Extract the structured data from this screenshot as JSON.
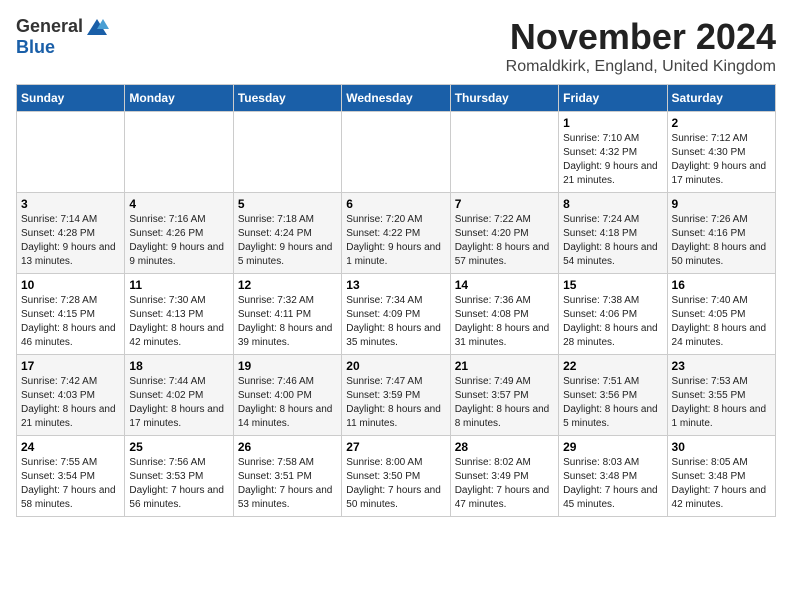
{
  "header": {
    "logo_general": "General",
    "logo_blue": "Blue",
    "month": "November 2024",
    "location": "Romaldkirk, England, United Kingdom"
  },
  "days_of_week": [
    "Sunday",
    "Monday",
    "Tuesday",
    "Wednesday",
    "Thursday",
    "Friday",
    "Saturday"
  ],
  "weeks": [
    [
      {
        "day": "",
        "info": ""
      },
      {
        "day": "",
        "info": ""
      },
      {
        "day": "",
        "info": ""
      },
      {
        "day": "",
        "info": ""
      },
      {
        "day": "",
        "info": ""
      },
      {
        "day": "1",
        "info": "Sunrise: 7:10 AM\nSunset: 4:32 PM\nDaylight: 9 hours and 21 minutes."
      },
      {
        "day": "2",
        "info": "Sunrise: 7:12 AM\nSunset: 4:30 PM\nDaylight: 9 hours and 17 minutes."
      }
    ],
    [
      {
        "day": "3",
        "info": "Sunrise: 7:14 AM\nSunset: 4:28 PM\nDaylight: 9 hours and 13 minutes."
      },
      {
        "day": "4",
        "info": "Sunrise: 7:16 AM\nSunset: 4:26 PM\nDaylight: 9 hours and 9 minutes."
      },
      {
        "day": "5",
        "info": "Sunrise: 7:18 AM\nSunset: 4:24 PM\nDaylight: 9 hours and 5 minutes."
      },
      {
        "day": "6",
        "info": "Sunrise: 7:20 AM\nSunset: 4:22 PM\nDaylight: 9 hours and 1 minute."
      },
      {
        "day": "7",
        "info": "Sunrise: 7:22 AM\nSunset: 4:20 PM\nDaylight: 8 hours and 57 minutes."
      },
      {
        "day": "8",
        "info": "Sunrise: 7:24 AM\nSunset: 4:18 PM\nDaylight: 8 hours and 54 minutes."
      },
      {
        "day": "9",
        "info": "Sunrise: 7:26 AM\nSunset: 4:16 PM\nDaylight: 8 hours and 50 minutes."
      }
    ],
    [
      {
        "day": "10",
        "info": "Sunrise: 7:28 AM\nSunset: 4:15 PM\nDaylight: 8 hours and 46 minutes."
      },
      {
        "day": "11",
        "info": "Sunrise: 7:30 AM\nSunset: 4:13 PM\nDaylight: 8 hours and 42 minutes."
      },
      {
        "day": "12",
        "info": "Sunrise: 7:32 AM\nSunset: 4:11 PM\nDaylight: 8 hours and 39 minutes."
      },
      {
        "day": "13",
        "info": "Sunrise: 7:34 AM\nSunset: 4:09 PM\nDaylight: 8 hours and 35 minutes."
      },
      {
        "day": "14",
        "info": "Sunrise: 7:36 AM\nSunset: 4:08 PM\nDaylight: 8 hours and 31 minutes."
      },
      {
        "day": "15",
        "info": "Sunrise: 7:38 AM\nSunset: 4:06 PM\nDaylight: 8 hours and 28 minutes."
      },
      {
        "day": "16",
        "info": "Sunrise: 7:40 AM\nSunset: 4:05 PM\nDaylight: 8 hours and 24 minutes."
      }
    ],
    [
      {
        "day": "17",
        "info": "Sunrise: 7:42 AM\nSunset: 4:03 PM\nDaylight: 8 hours and 21 minutes."
      },
      {
        "day": "18",
        "info": "Sunrise: 7:44 AM\nSunset: 4:02 PM\nDaylight: 8 hours and 17 minutes."
      },
      {
        "day": "19",
        "info": "Sunrise: 7:46 AM\nSunset: 4:00 PM\nDaylight: 8 hours and 14 minutes."
      },
      {
        "day": "20",
        "info": "Sunrise: 7:47 AM\nSunset: 3:59 PM\nDaylight: 8 hours and 11 minutes."
      },
      {
        "day": "21",
        "info": "Sunrise: 7:49 AM\nSunset: 3:57 PM\nDaylight: 8 hours and 8 minutes."
      },
      {
        "day": "22",
        "info": "Sunrise: 7:51 AM\nSunset: 3:56 PM\nDaylight: 8 hours and 5 minutes."
      },
      {
        "day": "23",
        "info": "Sunrise: 7:53 AM\nSunset: 3:55 PM\nDaylight: 8 hours and 1 minute."
      }
    ],
    [
      {
        "day": "24",
        "info": "Sunrise: 7:55 AM\nSunset: 3:54 PM\nDaylight: 7 hours and 58 minutes."
      },
      {
        "day": "25",
        "info": "Sunrise: 7:56 AM\nSunset: 3:53 PM\nDaylight: 7 hours and 56 minutes."
      },
      {
        "day": "26",
        "info": "Sunrise: 7:58 AM\nSunset: 3:51 PM\nDaylight: 7 hours and 53 minutes."
      },
      {
        "day": "27",
        "info": "Sunrise: 8:00 AM\nSunset: 3:50 PM\nDaylight: 7 hours and 50 minutes."
      },
      {
        "day": "28",
        "info": "Sunrise: 8:02 AM\nSunset: 3:49 PM\nDaylight: 7 hours and 47 minutes."
      },
      {
        "day": "29",
        "info": "Sunrise: 8:03 AM\nSunset: 3:48 PM\nDaylight: 7 hours and 45 minutes."
      },
      {
        "day": "30",
        "info": "Sunrise: 8:05 AM\nSunset: 3:48 PM\nDaylight: 7 hours and 42 minutes."
      }
    ]
  ]
}
